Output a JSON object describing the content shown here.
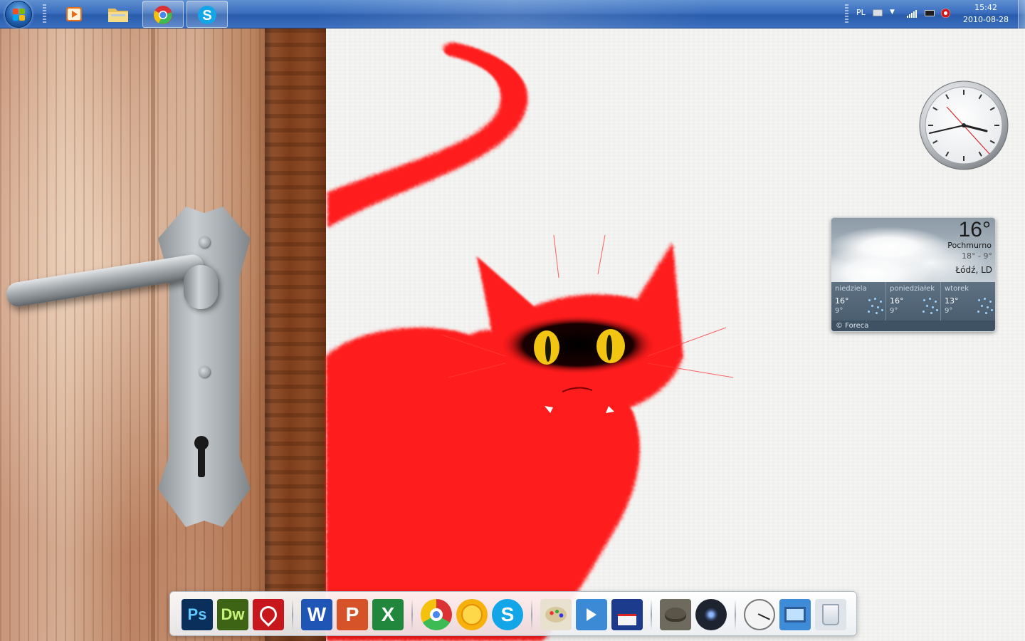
{
  "taskbar": {
    "apps": [
      {
        "name": "Windows Media Player",
        "icon": "media-player-icon"
      },
      {
        "name": "Windows Explorer",
        "icon": "folder-icon"
      },
      {
        "name": "Google Chrome",
        "icon": "chrome-icon"
      },
      {
        "name": "Skype",
        "icon": "skype-icon"
      }
    ],
    "tray": {
      "language": "PL",
      "icons": [
        "keyboard-icon",
        "show-hidden-icons-arrow",
        "network-signal-icon",
        "battery-icon",
        "action-center-icon"
      ]
    },
    "clock": {
      "time": "15:42",
      "date": "2010-08-28"
    },
    "colors": {
      "bar": "#3b6fbf",
      "active_button": "#ffffff"
    }
  },
  "clock_gadget": {
    "hour_hand": "about 3",
    "minute_hand": "about 42",
    "second_hand_color": "#d9262b"
  },
  "weather_gadget": {
    "temperature": "16°",
    "condition": "Pochmurno",
    "range": "18° - 9°",
    "location": "Łódź, LD",
    "forecast": [
      {
        "day": "niedziela",
        "high": "16°",
        "low": "9°",
        "icon": "rain-icon"
      },
      {
        "day": "poniedziałek",
        "high": "16°",
        "low": "9°",
        "icon": "rain-icon"
      },
      {
        "day": "wtorek",
        "high": "13°",
        "low": "9°",
        "icon": "rain-icon"
      }
    ],
    "credit": "© Foreca"
  },
  "dock": {
    "groups": [
      [
        {
          "name": "Photoshop",
          "label": "Ps",
          "icon": "photoshop-icon",
          "color": "#0a2f5a",
          "fg": "#5fc8ff"
        },
        {
          "name": "Dreamweaver",
          "label": "Dw",
          "icon": "dreamweaver-icon",
          "color": "#3d6314",
          "fg": "#c9f27a"
        },
        {
          "name": "Adobe Reader",
          "label": "",
          "icon": "acrobat-icon",
          "color": "#c8161d",
          "fg": "#ffffff"
        }
      ],
      [
        {
          "name": "Word",
          "label": "W",
          "icon": "word-icon",
          "color": "#1f55b5",
          "fg": "#ffffff"
        },
        {
          "name": "PowerPoint",
          "label": "P",
          "icon": "powerpoint-icon",
          "color": "#d6532a",
          "fg": "#ffffff"
        },
        {
          "name": "Excel",
          "label": "X",
          "icon": "excel-icon",
          "color": "#21873c",
          "fg": "#ffffff"
        }
      ],
      [
        {
          "name": "Google Chrome",
          "label": "",
          "icon": "chrome-icon",
          "color": "#2f7fe0",
          "fg": "#ffffff"
        },
        {
          "name": "Sun messenger",
          "label": "",
          "icon": "smiley-sun-icon",
          "color": "#f6b10d",
          "fg": "#ffffff"
        },
        {
          "name": "Skype",
          "label": "S",
          "icon": "skype-icon",
          "color": "#12a5e8",
          "fg": "#ffffff"
        }
      ],
      [
        {
          "name": "Paint",
          "label": "",
          "icon": "paint-palette-icon",
          "color": "#e8e1cf",
          "fg": "#333333"
        },
        {
          "name": "Media Player",
          "label": "",
          "icon": "media-player-icon",
          "color": "#3c8ad6",
          "fg": "#ffffff"
        },
        {
          "name": "Save",
          "label": "",
          "icon": "floppy-disk-icon",
          "color": "#1c3b8c",
          "fg": "#ffffff"
        }
      ],
      [
        {
          "name": "GIMP",
          "label": "",
          "icon": "gimp-icon",
          "color": "#6f6a5e",
          "fg": "#ffffff"
        },
        {
          "name": "Webcam",
          "label": "",
          "icon": "webcam-icon",
          "color": "#1d2430",
          "fg": "#8fb7ff"
        }
      ],
      [
        {
          "name": "Clock",
          "label": "",
          "icon": "clock-icon",
          "color": "#f4f4f4",
          "fg": "#222222"
        },
        {
          "name": "Computer",
          "label": "",
          "icon": "computer-icon",
          "color": "#3e8bd7",
          "fg": "#ffffff"
        },
        {
          "name": "Recycle Bin",
          "label": "",
          "icon": "recycle-bin-icon",
          "color": "#dfe4ea",
          "fg": "#3f7fbf"
        }
      ]
    ]
  },
  "wallpaper": {
    "description_colors": {
      "cat": "#ff1a1a",
      "background": "#f4f4f2",
      "door": "#c8957a",
      "handle": "#a4aaae"
    }
  }
}
